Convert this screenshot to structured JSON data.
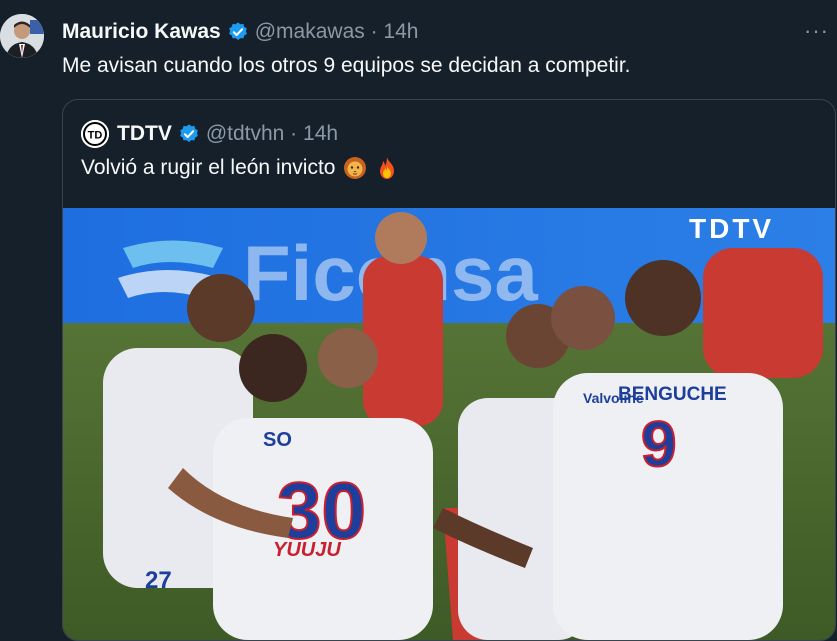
{
  "tweet": {
    "author_name": "Mauricio Kawas",
    "handle_time": "@makawas · 14h",
    "more_label": "···",
    "text": "Me avisan cuando los otros 9 equipos se decidan a competir."
  },
  "quote": {
    "author_name": "TDTV",
    "handle_time": "@tdtvhn · 14h",
    "text": "Volvió a rugir el león invicto"
  },
  "photo": {
    "watermark": "TDTV",
    "banner_text": "Ficohsa",
    "jersey_name": "BENGUCHE",
    "jersey_number_main": "9",
    "jersey_number_left": "30",
    "jersey_partial": "SO",
    "jersey_left_edge": "27",
    "sponsor_chest": "Valvoline",
    "sponsor_bottom": "YUUJU"
  },
  "colors": {
    "background": "#15202b",
    "text": "#f7f9f9",
    "muted": "#8b98a5",
    "verified": "#1d9bf0",
    "border": "#38444d"
  }
}
